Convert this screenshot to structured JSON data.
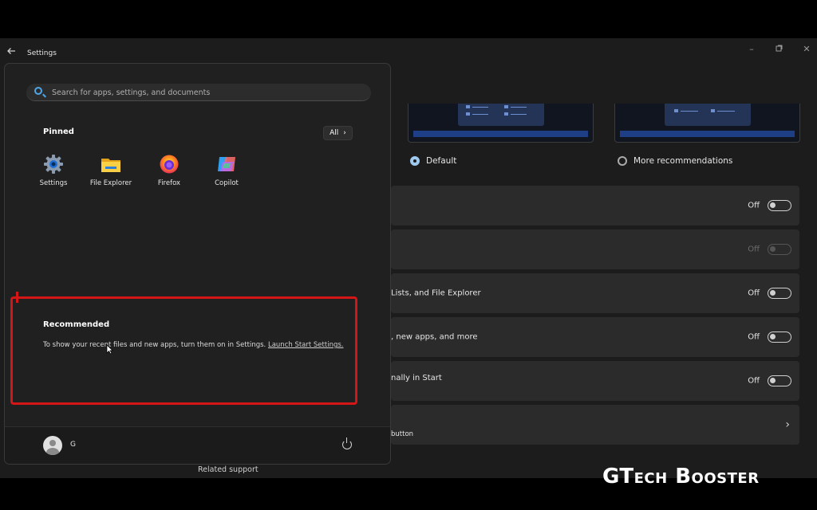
{
  "window": {
    "title": "Settings",
    "controls": [
      "minimize-icon",
      "maximize-icon",
      "close-icon"
    ]
  },
  "settings_bg": {
    "layouts": [
      {
        "label": "Default",
        "selected": true
      },
      {
        "label": "More recommendations",
        "selected": false
      }
    ],
    "rows": [
      {
        "label": "",
        "state": "Off",
        "disabled": false
      },
      {
        "label": "",
        "state": "Off",
        "disabled": true
      },
      {
        "label": "Lists, and File Explorer",
        "state": "Off",
        "disabled": false
      },
      {
        "label": ", new apps, and more",
        "state": "Off",
        "disabled": false
      },
      {
        "label": "nally in Start",
        "state": "Off",
        "disabled": false
      }
    ],
    "folders_row": {
      "label": "button"
    },
    "related_support": "Related support"
  },
  "start_menu": {
    "search": {
      "placeholder": "Search for apps, settings, and documents"
    },
    "pinned": {
      "title": "Pinned",
      "all_label": "All",
      "apps": [
        {
          "name": "Settings",
          "icon": "settings-gear-icon"
        },
        {
          "name": "File Explorer",
          "icon": "folder-icon"
        },
        {
          "name": "Firefox",
          "icon": "firefox-icon"
        },
        {
          "name": "Copilot",
          "icon": "copilot-icon"
        }
      ]
    },
    "recommended": {
      "title": "Recommended",
      "text": "To show your recent files and new apps, turn them on in Settings. ",
      "link": "Launch Start Settings."
    },
    "user": {
      "name": "G"
    }
  },
  "watermark": "GTech Booster",
  "colors": {
    "accent": "#4fa6e8",
    "annotation": "#d41616"
  }
}
